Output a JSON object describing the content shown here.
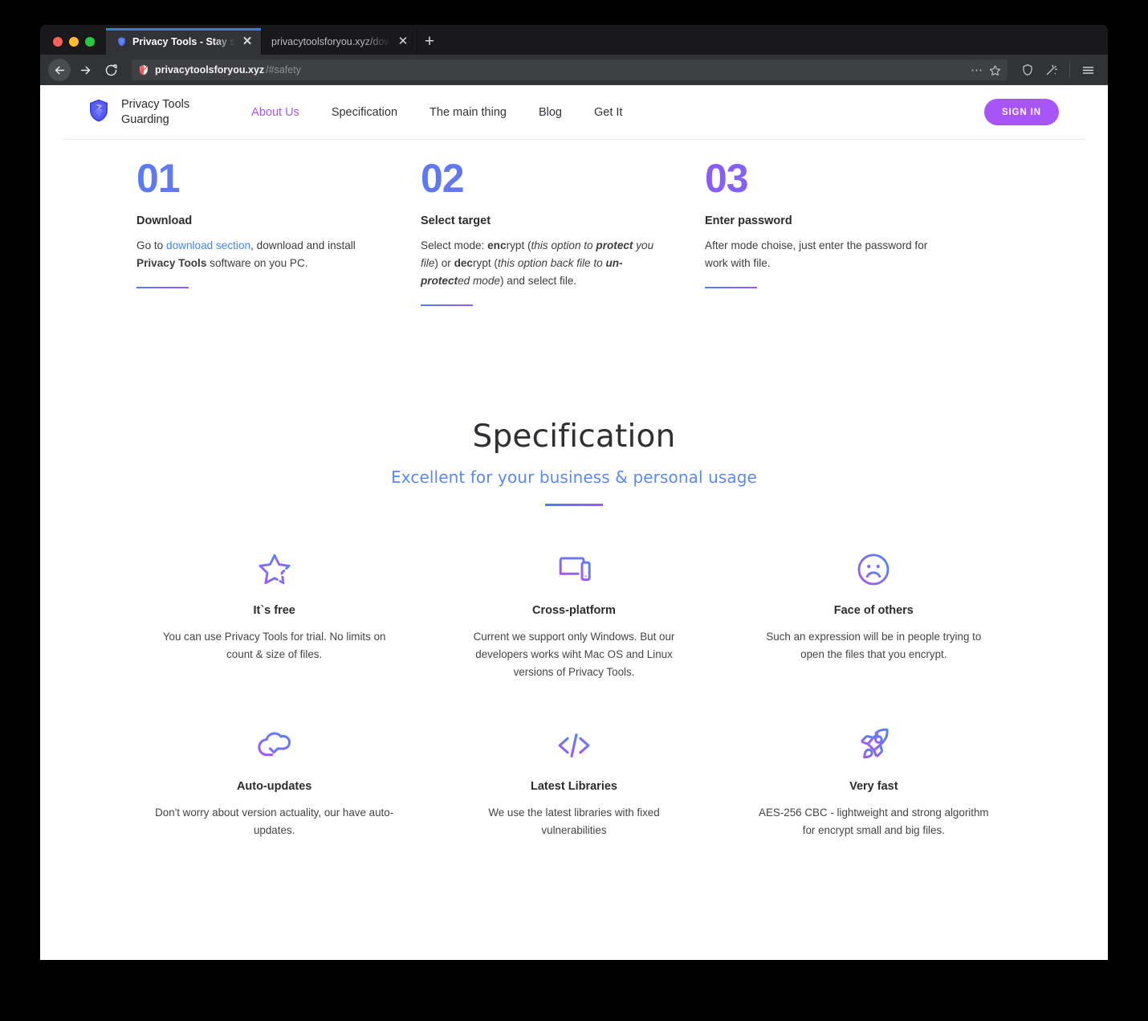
{
  "browser": {
    "tabs": [
      {
        "title": "Privacy Tools - Stay secure. Live",
        "active": true,
        "favicon": "shield-icon"
      },
      {
        "title": "privacytoolsforyou.xyz/downloads/a",
        "active": false,
        "favicon": "none"
      }
    ],
    "new_tab_label": "+",
    "close_label": "✕",
    "toolbar": {
      "back_label": "←",
      "forward_label": "→",
      "reload_label": "⟳",
      "url_host": "privacytoolsforyou.xyz",
      "url_path": "/#safety",
      "more_label": "⋯",
      "bookmark_icon": "star-icon",
      "shield_icon": "shield-icon",
      "sync_icon": "wand-icon",
      "menu_icon": "hamburger-menu-icon"
    }
  },
  "site": {
    "brand": {
      "name": "Privacy Tools\nGuarding",
      "logo": "shield-logo-icon"
    },
    "nav": [
      {
        "label": "About Us",
        "active": true
      },
      {
        "label": "Specification",
        "active": false
      },
      {
        "label": "The main thing",
        "active": false
      },
      {
        "label": "Blog",
        "active": false
      },
      {
        "label": "Get It",
        "active": false
      }
    ],
    "sign_in_label": "SIGN IN",
    "accent_purple": "#a855f7",
    "accent_blue": "#4285f4"
  },
  "steps": [
    {
      "number": "01",
      "title": "Download",
      "body_parts": [
        {
          "text": "Go to ",
          "style": "normal"
        },
        {
          "text": "download section",
          "style": "link"
        },
        {
          "text": ", download and install ",
          "style": "normal"
        },
        {
          "text": "Privacy Tools",
          "style": "bold"
        },
        {
          "text": " software on you PC.",
          "style": "normal"
        }
      ],
      "gradient_reversed": false
    },
    {
      "number": "02",
      "title": "Select target",
      "body_parts": [
        {
          "text": "Select mode: ",
          "style": "normal"
        },
        {
          "text": "enc",
          "style": "bold"
        },
        {
          "text": "rypt (",
          "style": "normal"
        },
        {
          "text": "this option to ",
          "style": "italic"
        },
        {
          "text": "protect",
          "style": "bold-italic"
        },
        {
          "text": " you file",
          "style": "italic"
        },
        {
          "text": ") or ",
          "style": "normal"
        },
        {
          "text": "dec",
          "style": "bold"
        },
        {
          "text": "rypt (",
          "style": "normal"
        },
        {
          "text": "this option back file to ",
          "style": "italic"
        },
        {
          "text": "un-protect",
          "style": "bold-italic"
        },
        {
          "text": "ed mode",
          "style": "italic"
        },
        {
          "text": ") and select file.",
          "style": "normal"
        }
      ],
      "gradient_reversed": false
    },
    {
      "number": "03",
      "title": "Enter password",
      "body_parts": [
        {
          "text": "After mode choise, just enter the password for work with file.",
          "style": "normal"
        }
      ],
      "gradient_reversed": true
    }
  ],
  "specification": {
    "title": "Specification",
    "subtitle": "Excellent for your business & personal usage",
    "features": [
      {
        "icon": "star-icon",
        "title": "It`s free",
        "text": "You can use Privacy Tools for trial. No limits on count & size of files."
      },
      {
        "icon": "devices-laptop-phone-icon",
        "title": "Cross-platform",
        "text": "Current we support only Windows. But our developers works wiht Mac OS and Linux versions of Privacy Tools."
      },
      {
        "icon": "sad-face-icon",
        "title": "Face of others",
        "text": "Such an expression will be in people trying to open the files that you encrypt."
      },
      {
        "icon": "cloud-download-icon",
        "title": "Auto-updates",
        "text": "Don't worry about version actuality, our have auto-updates."
      },
      {
        "icon": "code-brackets-icon",
        "title": "Latest Libraries",
        "text": "We use the latest libraries with fixed vulnerabilities"
      },
      {
        "icon": "rocket-icon",
        "title": "Very fast",
        "text": "AES-256 CBC - lightweight and strong algorithm for encrypt small and big files."
      }
    ]
  }
}
